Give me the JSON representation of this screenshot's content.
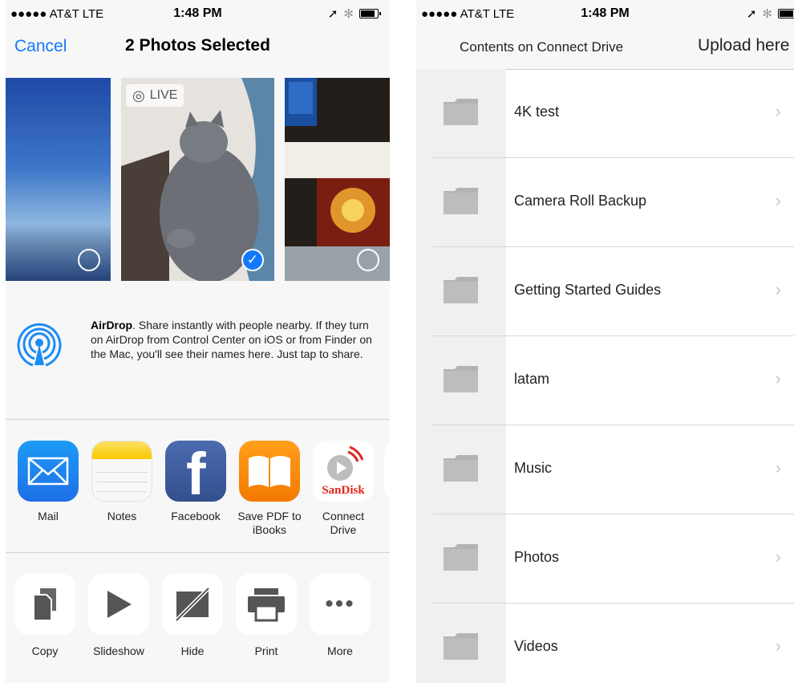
{
  "left": {
    "status": {
      "carrier": "●●●●● AT&T  LTE",
      "time": "1:48 PM"
    },
    "header": {
      "cancel": "Cancel",
      "title": "2 Photos Selected"
    },
    "photos": [
      {
        "live": null,
        "selected": false
      },
      {
        "live": "LIVE",
        "selected": true
      },
      {
        "live": null,
        "selected": false
      }
    ],
    "airdrop": {
      "title": "AirDrop",
      "text": ". Share instantly with people nearby. If they turn on AirDrop from Control Center on iOS or from Finder on the Mac, you'll see their names here. Just tap to share."
    },
    "apps": [
      {
        "label": "Mail",
        "icon": "mail-icon"
      },
      {
        "label": "Notes",
        "icon": "notes-icon"
      },
      {
        "label": "Facebook",
        "icon": "facebook-icon"
      },
      {
        "label": "Save PDF to iBooks",
        "icon": "ibooks-icon"
      },
      {
        "label": "Connect Drive",
        "icon": "sandisk-icon",
        "brand": "SanDisk"
      }
    ],
    "actions": [
      {
        "label": "Copy",
        "icon": "copy-icon"
      },
      {
        "label": "Slideshow",
        "icon": "slideshow-icon"
      },
      {
        "label": "Hide",
        "icon": "hide-icon"
      },
      {
        "label": "Print",
        "icon": "print-icon"
      },
      {
        "label": "More",
        "icon": "more-icon"
      }
    ]
  },
  "right": {
    "status": {
      "carrier": "●●●●● AT&T  LTE",
      "time": "1:48 PM"
    },
    "header": {
      "title": "Contents on Connect Drive",
      "upload": "Upload here"
    },
    "folders": [
      "4K test",
      "Camera Roll Backup",
      "Getting Started Guides",
      "latam",
      "Music",
      "Photos",
      "Videos"
    ]
  },
  "colors": {
    "accent": "#1479fa",
    "folder": "#b3b3b3",
    "separator": "#d1d1d1"
  }
}
